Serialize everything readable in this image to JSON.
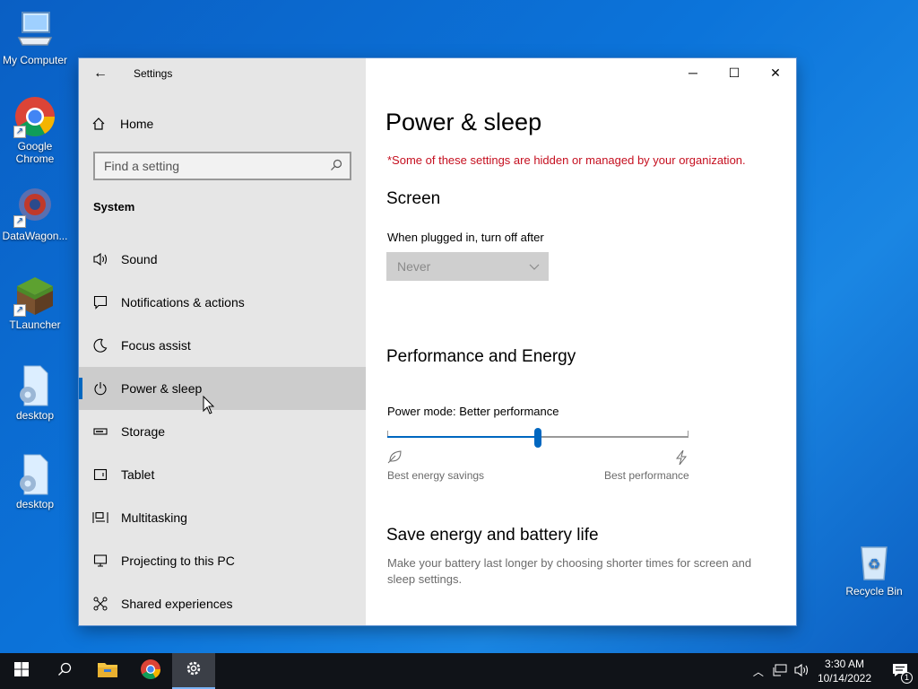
{
  "desktop": {
    "icons": [
      {
        "label": "My Computer"
      },
      {
        "label": "Google Chrome"
      },
      {
        "label": "DataWagon..."
      },
      {
        "label": "TLauncher"
      },
      {
        "label": "desktop"
      },
      {
        "label": "desktop"
      },
      {
        "label": "Recycle Bin"
      }
    ]
  },
  "window": {
    "title": "Settings",
    "home_label": "Home",
    "search_placeholder": "Find a setting",
    "section_label": "System",
    "nav_items": [
      {
        "label": "Sound",
        "icon": "speaker-icon"
      },
      {
        "label": "Notifications & actions",
        "icon": "message-icon"
      },
      {
        "label": "Focus assist",
        "icon": "moon-icon"
      },
      {
        "label": "Power & sleep",
        "icon": "power-icon",
        "active": true
      },
      {
        "label": "Storage",
        "icon": "storage-icon"
      },
      {
        "label": "Tablet",
        "icon": "tablet-icon"
      },
      {
        "label": "Multitasking",
        "icon": "multitasking-icon"
      },
      {
        "label": "Projecting to this PC",
        "icon": "projector-icon"
      },
      {
        "label": "Shared experiences",
        "icon": "shared-icon"
      }
    ]
  },
  "main": {
    "title": "Power & sleep",
    "warning": "*Some of these settings are hidden or managed by your organization.",
    "screen_heading": "Screen",
    "plugged_in_label": "When plugged in, turn off after",
    "plugged_in_value": "Never",
    "performance_heading": "Performance and Energy",
    "power_mode_label": "Power mode: Better performance",
    "power_mode_level": 0.5,
    "slider_min_label": "Best energy savings",
    "slider_max_label": "Best performance",
    "save_heading": "Save energy and battery life",
    "save_desc": "Make your battery last longer by choosing shorter times for screen and sleep settings."
  },
  "taskbar": {
    "time": "3:30 AM",
    "date": "10/14/2022",
    "notification_count": "1"
  }
}
